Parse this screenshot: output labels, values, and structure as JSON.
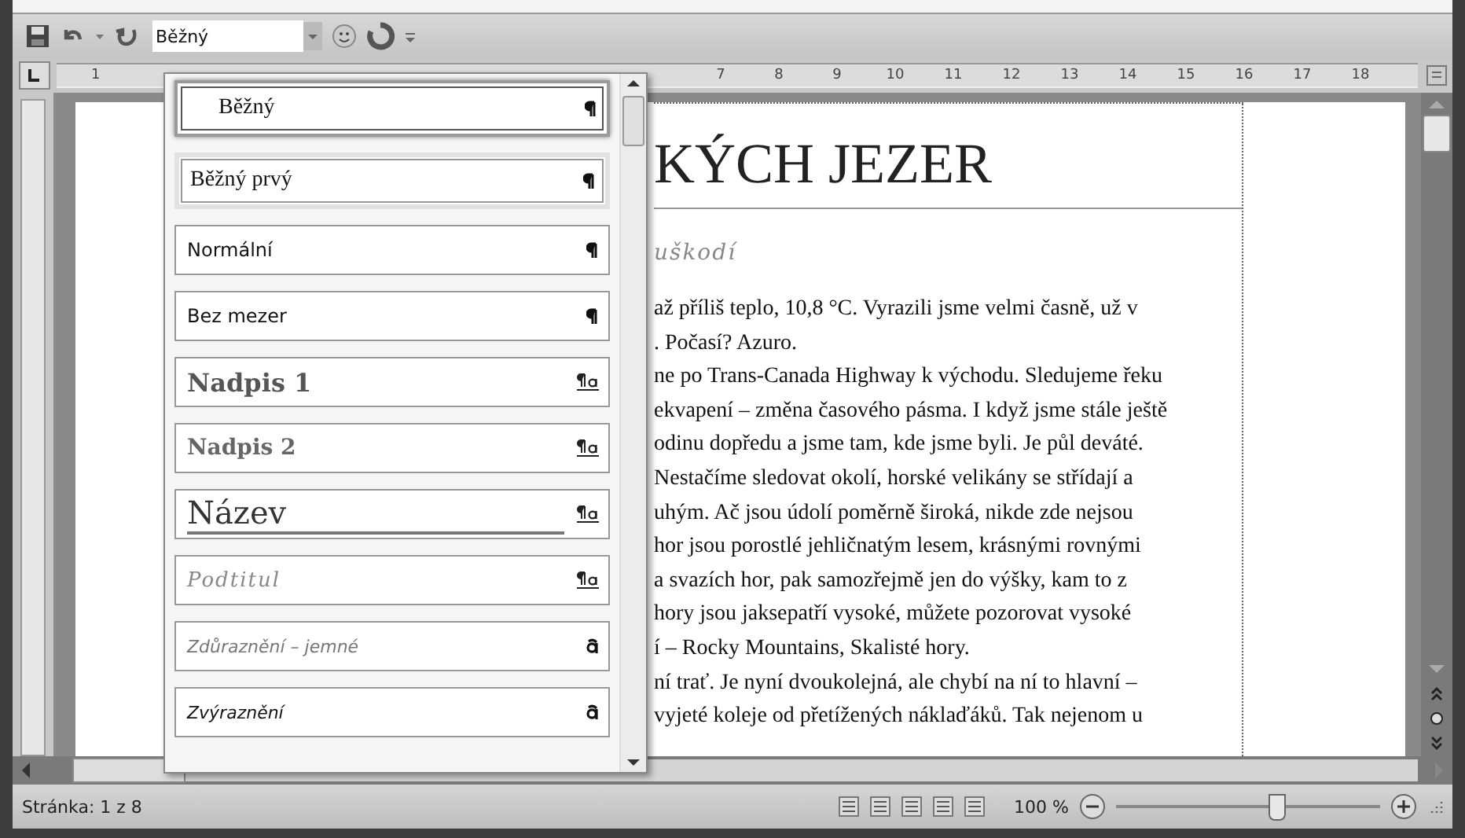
{
  "quick_access": {
    "style_box": {
      "value": "Běžný"
    }
  },
  "ruler": {
    "left_numbers": [
      "1"
    ],
    "right_numbers": [
      "7",
      "8",
      "9",
      "10",
      "11",
      "12",
      "13",
      "14",
      "15",
      "16",
      "17",
      "18"
    ]
  },
  "document": {
    "title": "KÝCH JEZER",
    "subtitle": "uškodí",
    "lines": [
      "až příliš teplo, 10,8 °C. Vyrazili jsme velmi časně, už v",
      ". Počasí? Azuro.",
      "ne po Trans-Canada Highway k východu. Sledujeme řeku",
      "ekvapení – změna časového pásma. I když jsme stále ještě",
      "odinu dopředu a jsme tam, kde jsme byli. Je půl deváté.",
      "Nestačíme sledovat okolí, horské velikány se střídají a",
      "uhým. Ač jsou údolí poměrně široká, nikde zde nejsou",
      "hor jsou porostlé jehličnatým lesem, krásnými rovnými",
      "a svazích hor, pak samozřejmě jen do výšky, kam to z",
      "hory jsou jaksepatří vysoké, můžete pozorovat vysoké",
      "í – Rocky Mountains, Skalisté hory.",
      "ní trať. Je nyní dvoukolejná, ale chybí na ní to hlavní –",
      "vyjeté koleje od přetížených náklaďáků. Tak nejenom u"
    ]
  },
  "styles_gallery": {
    "items": [
      {
        "label": "Běžný",
        "kind": "paragraph",
        "selected": true,
        "hovered": false
      },
      {
        "label": "Běžný prvý",
        "kind": "paragraph",
        "selected": false,
        "hovered": true
      },
      {
        "label": "Normální",
        "kind": "paragraph",
        "selected": false,
        "hovered": false
      },
      {
        "label": "Bez mezer",
        "kind": "paragraph",
        "selected": false,
        "hovered": false
      },
      {
        "label": "Nadpis 1",
        "kind": "linked",
        "selected": false,
        "hovered": false
      },
      {
        "label": "Nadpis 2",
        "kind": "linked",
        "selected": false,
        "hovered": false
      },
      {
        "label": "Název",
        "kind": "linked",
        "selected": false,
        "hovered": false
      },
      {
        "label": "Podtitul",
        "kind": "linked",
        "selected": false,
        "hovered": false
      },
      {
        "label": "Zdůraznění – jemné",
        "kind": "character",
        "selected": false,
        "hovered": false
      },
      {
        "label": "Zvýraznění",
        "kind": "character",
        "selected": false,
        "hovered": false
      }
    ]
  },
  "status_bar": {
    "page": "Stránka: 1 z 8",
    "zoom": "100 %",
    "zoom_level": {
      "level": 0.6
    }
  }
}
